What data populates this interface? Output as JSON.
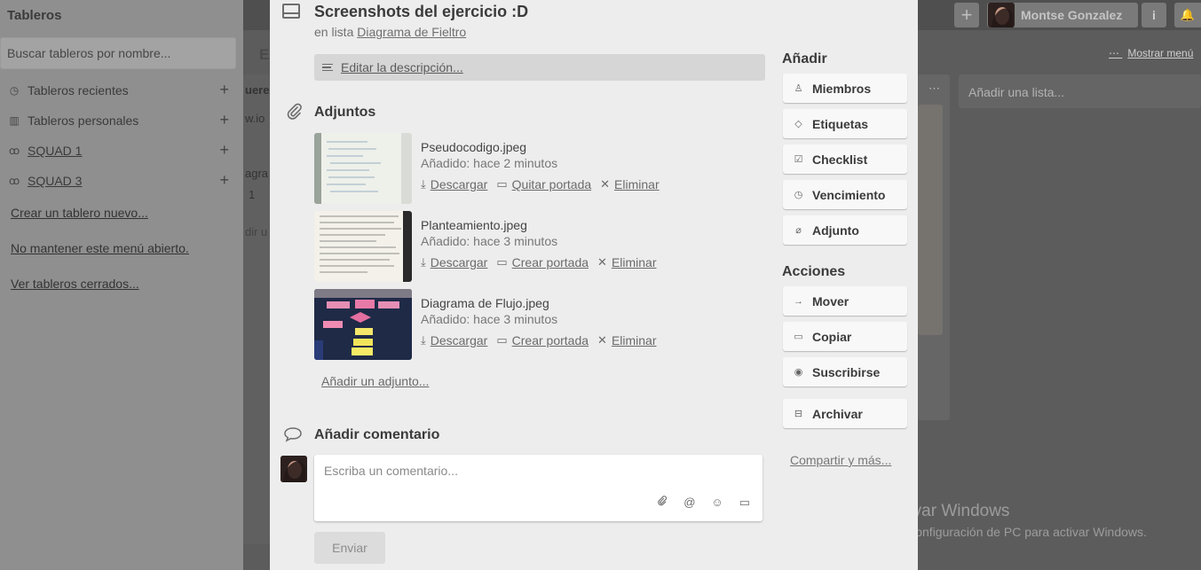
{
  "sidebar": {
    "title": "Tableros",
    "search_placeholder": "Buscar tableros por nombre...",
    "items": [
      {
        "label": "Tableros recientes",
        "icon": "clock-icon"
      },
      {
        "label": "Tableros personales",
        "icon": "board-icon"
      },
      {
        "label": "SQUAD 1",
        "icon": "team-icon"
      },
      {
        "label": "SQUAD 3",
        "icon": "team-icon"
      }
    ],
    "links": [
      "Crear un tablero nuevo...",
      "No mantener este menú abierto.",
      "Ver tableros cerrados..."
    ]
  },
  "header": {
    "user_name": "Montse Gonzalez",
    "show_menu": "Mostrar menú"
  },
  "board": {
    "add_list": "Añadir una lista...",
    "fragments": [
      "Ee",
      "ueren",
      "w.io",
      "agra",
      "1",
      "dir u"
    ]
  },
  "card": {
    "title": "Screenshots del ejercicio :D",
    "in_list_prefix": "en lista",
    "list_name": "Diagrama de Fieltro",
    "edit_description": "Editar la descripción...",
    "attachments_title": "Adjuntos",
    "attachments": [
      {
        "name": "Pseudocodigo.jpeg",
        "added": "Añadido: hace 2 minutos",
        "download": "Descargar",
        "cover": "Quitar portada",
        "delete": "Eliminar"
      },
      {
        "name": "Planteamiento.jpeg",
        "added": "Añadido: hace 3 minutos",
        "download": "Descargar",
        "cover": "Crear portada",
        "delete": "Eliminar"
      },
      {
        "name": "Diagrama de Flujo.jpeg",
        "added": "Añadido: hace 3 minutos",
        "download": "Descargar",
        "cover": "Crear portada",
        "delete": "Eliminar"
      }
    ],
    "add_attachment": "Añadir un adjunto...",
    "comment_title": "Añadir comentario",
    "comment_placeholder": "Escriba un comentario...",
    "send": "Enviar"
  },
  "sidebar_actions": {
    "add_title": "Añadir",
    "add_buttons": [
      "Miembros",
      "Etiquetas",
      "Checklist",
      "Vencimiento",
      "Adjunto"
    ],
    "actions_title": "Acciones",
    "action_buttons": [
      "Mover",
      "Copiar",
      "Suscribirse",
      "Archivar"
    ],
    "share": "Compartir y más..."
  },
  "watermark": {
    "line1": "Activar Windows",
    "line2": "Ir a Configuración de PC para activar Windows."
  }
}
